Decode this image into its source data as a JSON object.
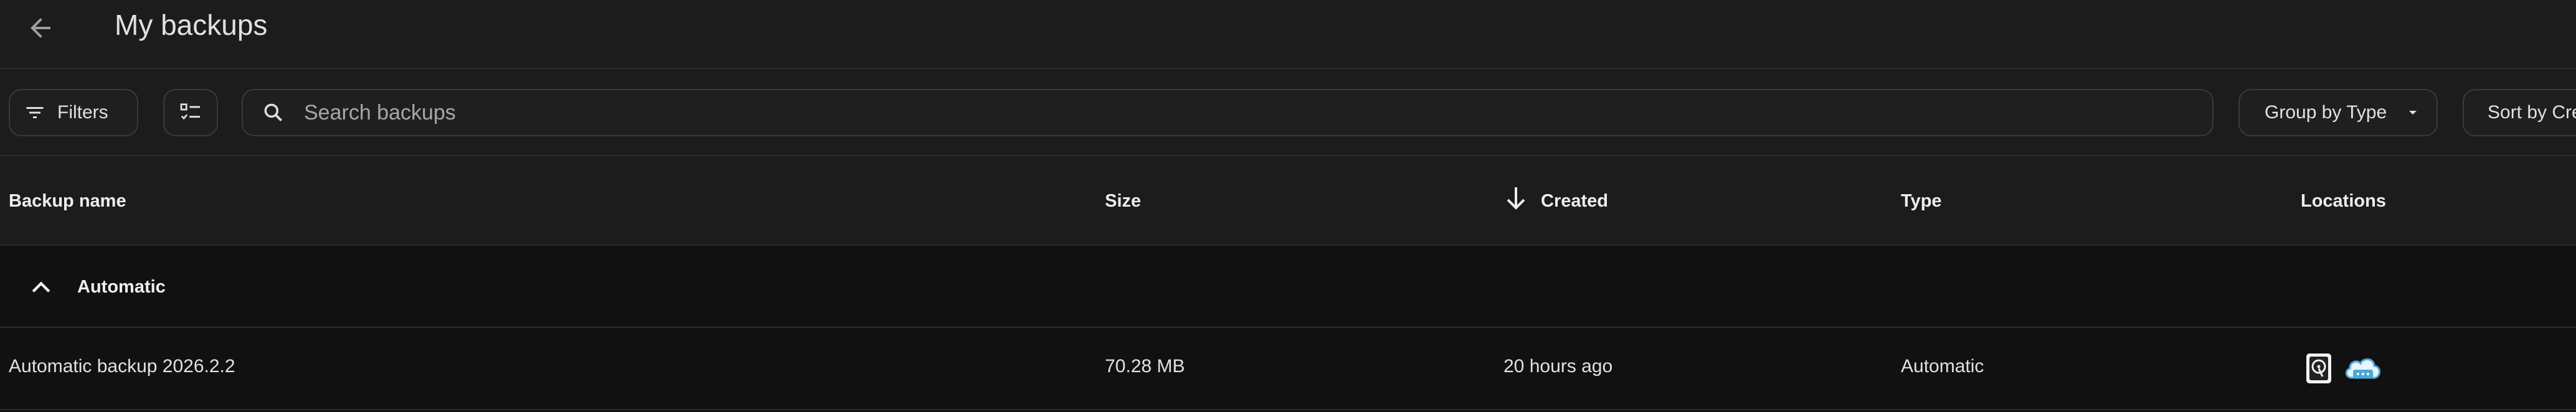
{
  "header": {
    "title": "My backups",
    "back_icon": "arrow-left-icon"
  },
  "toolbar": {
    "filters_label": "Filters",
    "filters_icon": "filter-lines-icon",
    "select_icon": "checklist-select-icon",
    "search": {
      "icon": "search-icon",
      "placeholder": "Search backups",
      "value": ""
    },
    "group_by_label": "Group by Type",
    "sort_by_label": "Sort by Created"
  },
  "table": {
    "columns": [
      "Backup name",
      "Size",
      "Created",
      "Type",
      "Locations"
    ],
    "sorted_column": "Created",
    "sort_direction": "descending",
    "groups": [
      {
        "label": "Automatic",
        "expanded": true,
        "rows": [
          {
            "name": "Automatic backup 2026.2.2",
            "size": "70.28 MB",
            "created": "20 hours ago",
            "type": "Automatic",
            "locations": [
              "hard-drive-icon",
              "cloud-icon"
            ]
          }
        ]
      }
    ]
  },
  "colors": {
    "background": "#111111",
    "surface": "#1c1c1c",
    "border": "#2b2b2b",
    "text": "#e1e1e1",
    "cloud_accent": "#4aa8d8"
  }
}
